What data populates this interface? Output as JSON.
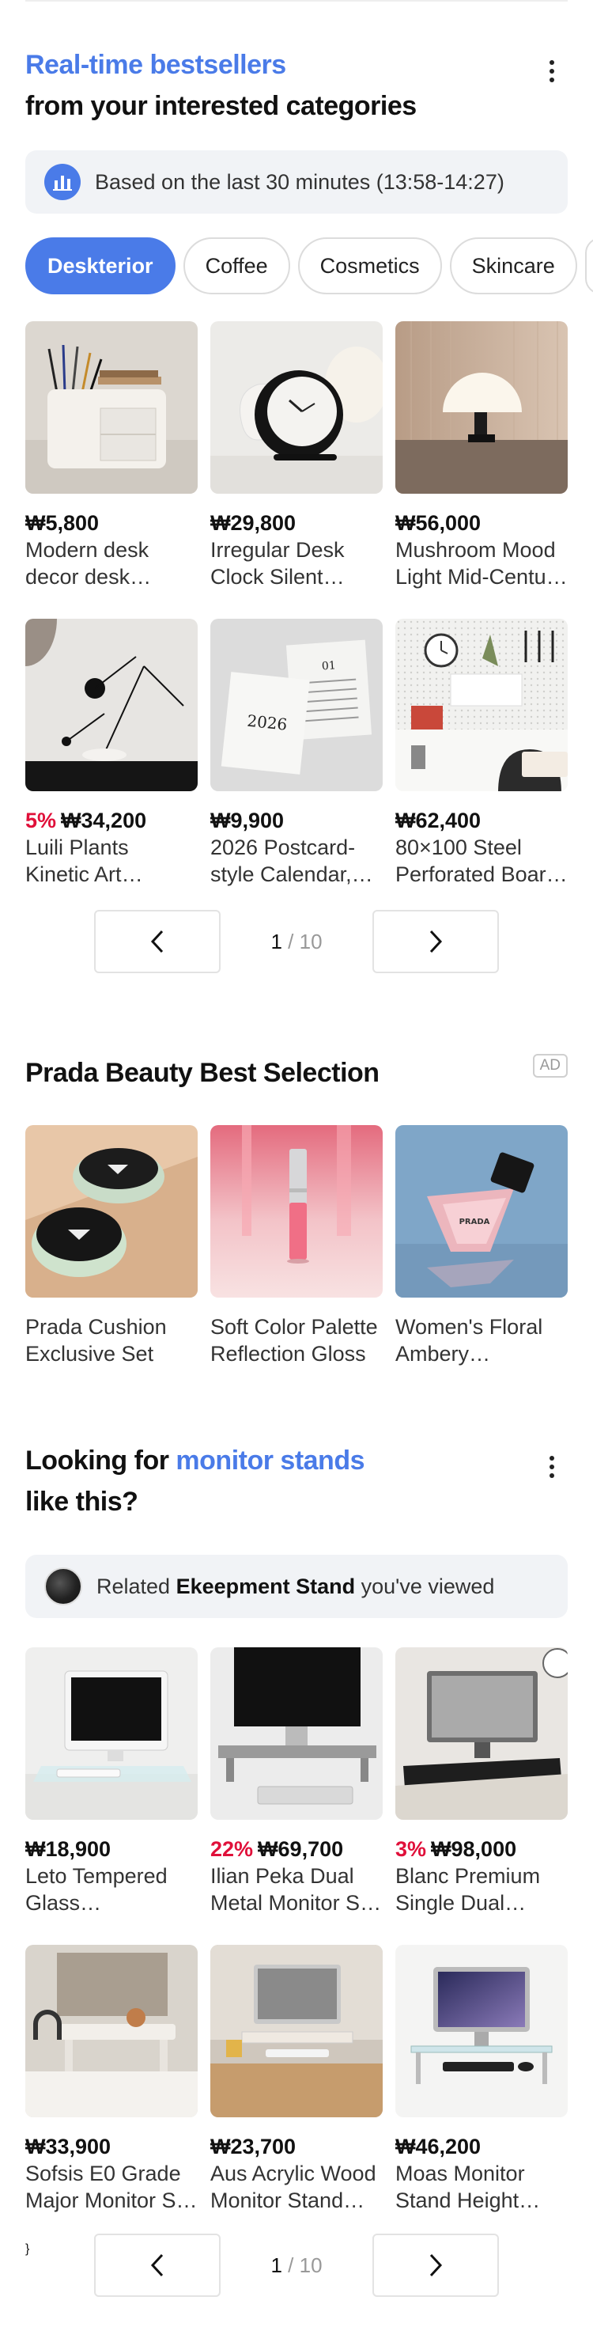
{
  "bestsellers": {
    "title_line1": "Real-time bestsellers",
    "title_line2": "from your interested categories",
    "more_icon": "more-vertical-icon",
    "info_text": "Based on the last 30 minutes (13:58-14:27)",
    "info_icon": "bar-chart-icon",
    "categories": [
      "Deskterior",
      "Coffee",
      "Cosmetics",
      "Skincare"
    ],
    "selected_category": "Deskterior",
    "products": [
      {
        "discount": "",
        "price": "₩5,800",
        "name": "Modern desk decor desk orga…"
      },
      {
        "discount": "",
        "price": "₩29,800",
        "name": "Irregular Desk Clock Silent Mini…"
      },
      {
        "discount": "",
        "price": "₩56,000",
        "name": "Mushroom Mood Light Mid-Centu…"
      },
      {
        "discount": "5%",
        "price": "₩34,200",
        "name": "Luili Plants Kinetic Art Sentimental…"
      },
      {
        "discount": "",
        "price": "₩9,900",
        "name": "2026 Postcard-style Calendar,…"
      },
      {
        "discount": "",
        "price": "₩62,400",
        "name": "80×100 Steel Perforated Boar…"
      }
    ],
    "calendar_year": "2026",
    "calendar_day": "01",
    "pager": {
      "current": "1",
      "separator": "/",
      "total": "10"
    }
  },
  "prada": {
    "title": "Prada Beauty Best Selection",
    "ad_label": "AD",
    "items": [
      {
        "name": "Prada Cushion Exclusive Set"
      },
      {
        "name": "Soft Color Palette Reflection Gloss"
      },
      {
        "name": "Women's Floral Ambery Fragrance"
      }
    ],
    "bottle_brand": "PRADA"
  },
  "monitor": {
    "title_prefix": "Looking for ",
    "title_accent": "monitor stands",
    "title_line2": "like this?",
    "more_icon": "more-vertical-icon",
    "related_prefix": "Related ",
    "related_bold": "Ekeepment Stand",
    "related_suffix": " you've viewed",
    "products": [
      {
        "discount": "",
        "price": "₩18,900",
        "name": "Leto Tempered Glass Computer…"
      },
      {
        "discount": "22%",
        "price": "₩69,700",
        "name": "Ilian Peka Dual Metal Monitor S…"
      },
      {
        "discount": "3%",
        "price": "₩98,000",
        "name": "Blanc Premium Single Dual Tripl…"
      },
      {
        "discount": "",
        "price": "₩33,900",
        "name": "Sofsis E0 Grade Major Monitor S…"
      },
      {
        "discount": "",
        "price": "₩23,700",
        "name": "Aus Acrylic Wood Monitor Stand H…"
      },
      {
        "discount": "",
        "price": "₩46,200",
        "name": "Moas Monitor Stand Height Ad…"
      }
    ],
    "pager": {
      "current": "1",
      "separator": "/",
      "total": "10"
    }
  },
  "colors": {
    "accent": "#4a7be8",
    "discount": "#e0103a"
  }
}
